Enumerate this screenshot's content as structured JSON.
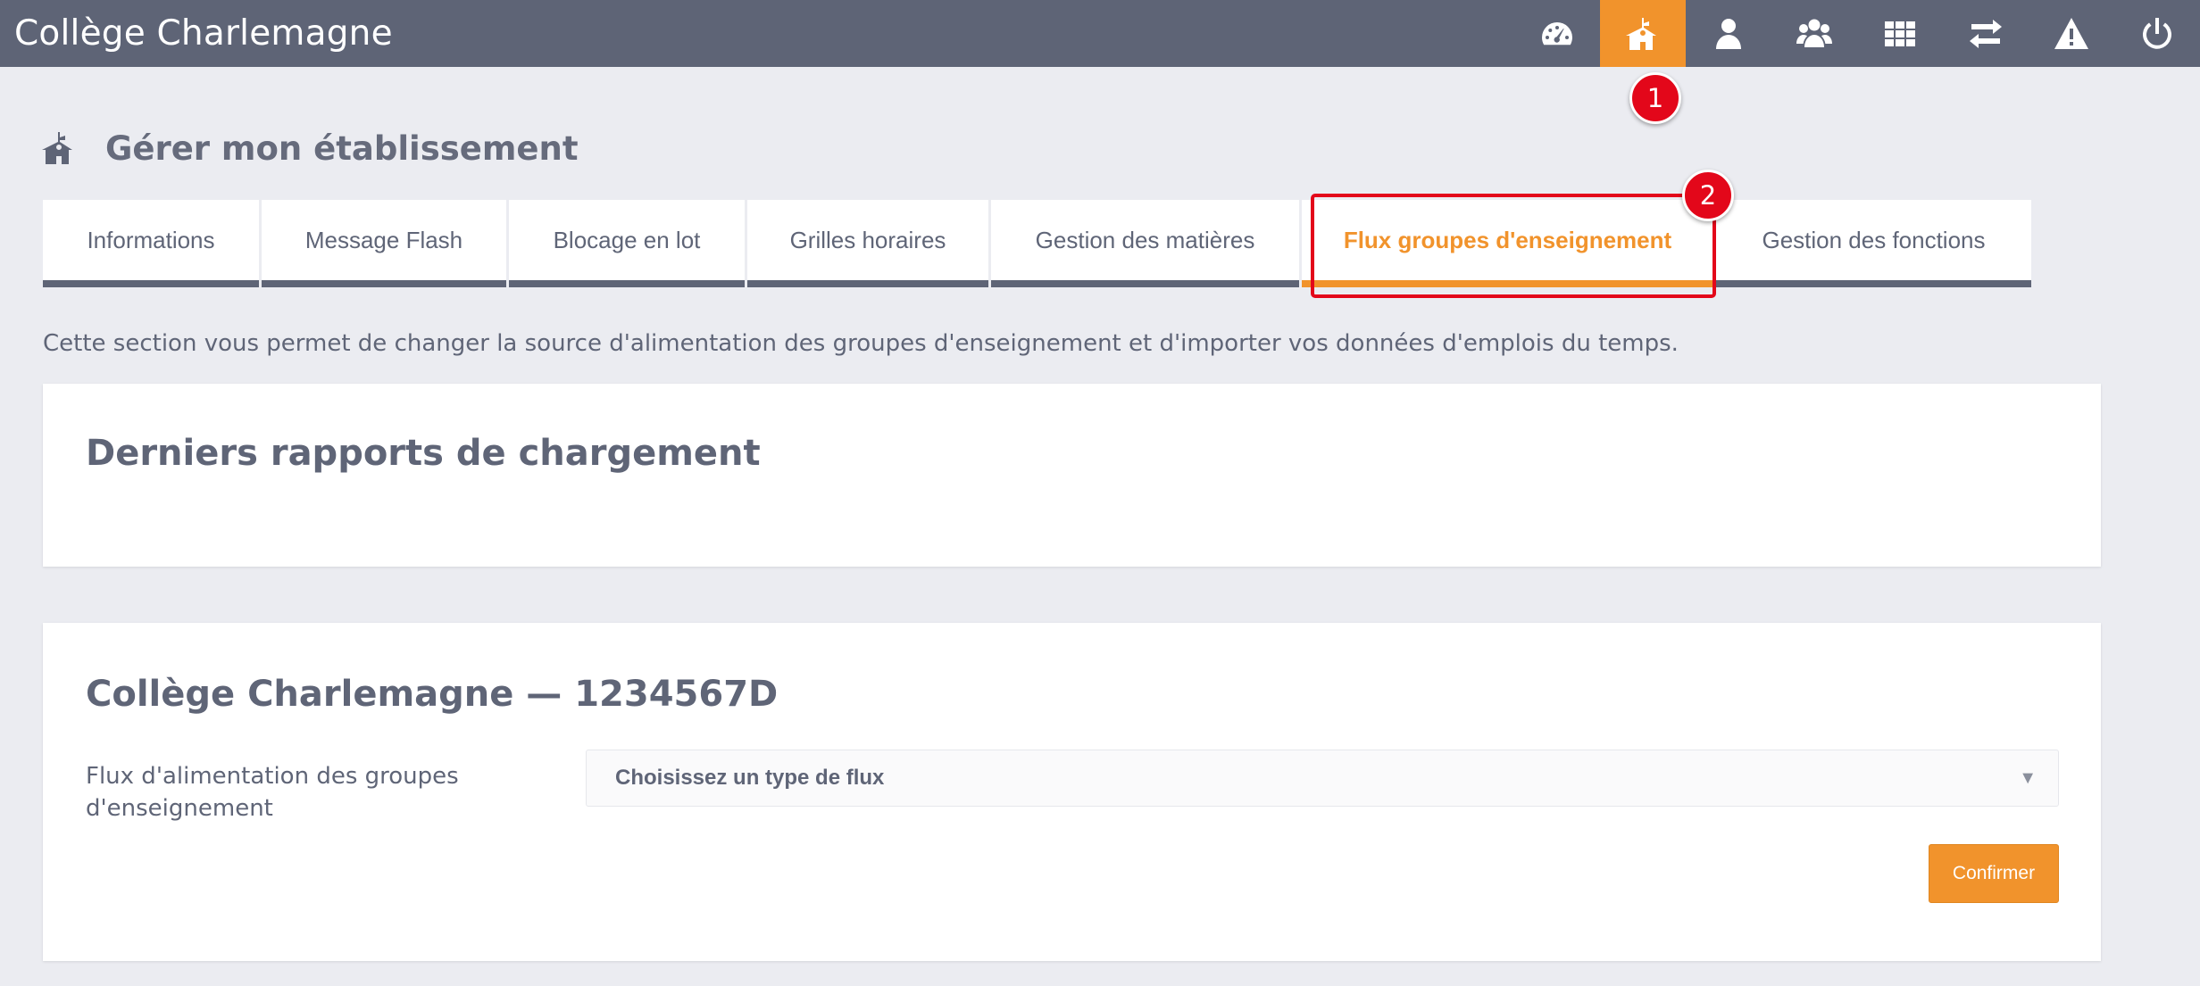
{
  "app": {
    "title": "Collège Charlemagne"
  },
  "nav": {
    "items": [
      {
        "icon": "dashboard-gauge-icon",
        "active": false
      },
      {
        "icon": "school-building-icon",
        "active": true
      },
      {
        "icon": "user-icon",
        "active": false
      },
      {
        "icon": "users-group-icon",
        "active": false
      },
      {
        "icon": "grid-apps-icon",
        "active": false
      },
      {
        "icon": "transfer-arrows-icon",
        "active": false
      },
      {
        "icon": "warning-icon",
        "active": false
      },
      {
        "icon": "power-icon",
        "active": false
      }
    ]
  },
  "callouts": {
    "first": "1",
    "second": "2"
  },
  "page": {
    "title": "Gérer mon établissement",
    "icon": "school-building-icon"
  },
  "tabs": [
    {
      "label": "Informations",
      "active": false
    },
    {
      "label": "Message Flash",
      "active": false
    },
    {
      "label": "Blocage en lot",
      "active": false
    },
    {
      "label": "Grilles horaires",
      "active": false
    },
    {
      "label": "Gestion des matières",
      "active": false
    },
    {
      "label": "Flux groupes d'enseignement",
      "active": true
    },
    {
      "label": "Gestion des fonctions",
      "active": false
    }
  ],
  "intro": "Cette section vous permet de changer la source d'alimentation des groupes d'enseignement et d'importer vos données d'emplois du temps.",
  "reports": {
    "title": "Derniers rapports de chargement"
  },
  "school": {
    "title": "Collège Charlemagne — 1234567D",
    "field_label": "Flux d'alimentation des groupes d'enseignement",
    "select_value": "Choisissez un type de flux",
    "confirm_label": "Confirmer"
  },
  "colors": {
    "topbar": "#5e6476",
    "accent": "#f1932c",
    "callout": "#e3071a",
    "background": "#ebecf1"
  }
}
